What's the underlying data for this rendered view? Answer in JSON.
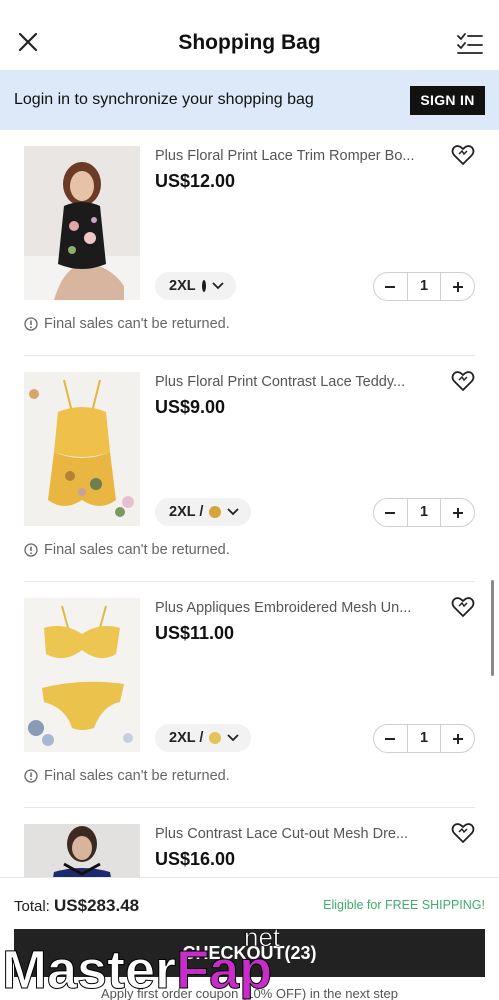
{
  "header": {
    "title": "Shopping Bag",
    "close_icon": "close-icon",
    "list_icon": "checklist-icon"
  },
  "login_banner": {
    "text": "Login in to synchronize your shopping bag",
    "button_label": "SIGN IN"
  },
  "items": [
    {
      "name": "Plus Floral Print Lace Trim Romper Bo...",
      "price": "US$12.00",
      "size": "2XL",
      "qty": "1",
      "note": "Final sales can't be returned.",
      "swatch_color": "#1b1b1b"
    },
    {
      "name": "Plus Floral Print Contrast Lace Teddy...",
      "price": "US$9.00",
      "size": "2XL /",
      "qty": "1",
      "note": "Final sales can't be returned.",
      "swatch_color": "#d7a53a"
    },
    {
      "name": "Plus Appliques Embroidered Mesh Un...",
      "price": "US$11.00",
      "size": "2XL /",
      "qty": "1",
      "note": "Final sales can't be returned.",
      "swatch_color": "#e2c45a"
    },
    {
      "name": "Plus Contrast Lace Cut-out Mesh Dre...",
      "price": "US$16.00"
    }
  ],
  "footer": {
    "total_label": "Total:",
    "total_value": "US$283.48",
    "free_shipping": "Eligible for FREE SHIPPING!",
    "checkout_label": "CHECKOUT(23)",
    "coupon_note": "Apply first order coupon (10% OFF) in the next step"
  },
  "watermark": {
    "text": "MasterFap",
    "suffix": "net"
  },
  "colors": {
    "banner_bg": "#dde9f8",
    "accent_green": "#3fae6a",
    "button_dark": "#111111"
  }
}
